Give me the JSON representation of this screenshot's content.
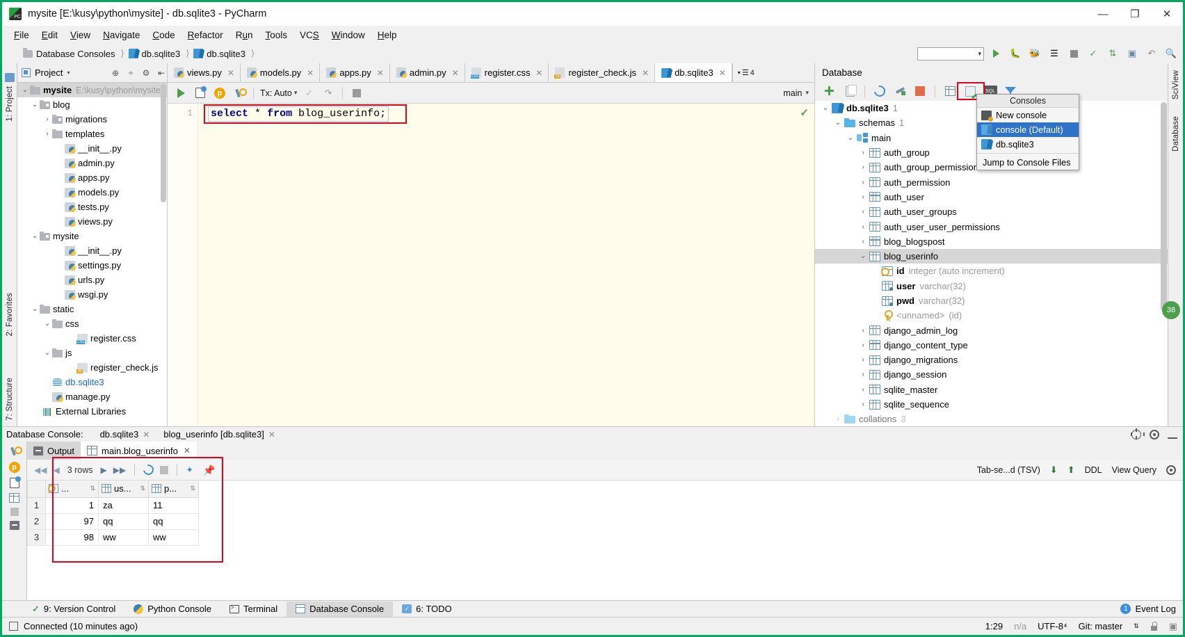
{
  "window": {
    "title": "mysite [E:\\kusy\\python\\mysite] - db.sqlite3 - PyCharm",
    "minimize": "—",
    "maximize": "❐",
    "close": "✕"
  },
  "menubar": [
    {
      "label": "File"
    },
    {
      "label": "Edit"
    },
    {
      "label": "View"
    },
    {
      "label": "Navigate"
    },
    {
      "label": "Code"
    },
    {
      "label": "Refactor"
    },
    {
      "label": "Run"
    },
    {
      "label": "Tools"
    },
    {
      "label": "VCS"
    },
    {
      "label": "Window"
    },
    {
      "label": "Help"
    }
  ],
  "breadcrumb": [
    {
      "label": "Database Consoles",
      "icon": "folder-icon"
    },
    {
      "label": "db.sqlite3",
      "icon": "console-icon"
    },
    {
      "label": "db.sqlite3",
      "icon": "console-icon"
    }
  ],
  "project_panel": {
    "title": "Project",
    "tree": [
      {
        "label": "mysite",
        "path": "E:\\kusy\\python\\mysite",
        "indent": 0,
        "arrow": "⌄",
        "icon": "folder-icon",
        "bold": true,
        "selected": true
      },
      {
        "label": "blog",
        "indent": 1,
        "arrow": "⌄",
        "icon": "source-folder-icon"
      },
      {
        "label": "migrations",
        "indent": 2,
        "arrow": "›",
        "icon": "source-folder-icon"
      },
      {
        "label": "templates",
        "indent": 2,
        "arrow": "›",
        "icon": "folder-icon"
      },
      {
        "label": "__init__.py",
        "indent": 3,
        "arrow": "",
        "icon": "python-file-icon"
      },
      {
        "label": "admin.py",
        "indent": 3,
        "arrow": "",
        "icon": "python-file-icon"
      },
      {
        "label": "apps.py",
        "indent": 3,
        "arrow": "",
        "icon": "python-file-icon"
      },
      {
        "label": "models.py",
        "indent": 3,
        "arrow": "",
        "icon": "python-file-icon"
      },
      {
        "label": "tests.py",
        "indent": 3,
        "arrow": "",
        "icon": "python-file-icon"
      },
      {
        "label": "views.py",
        "indent": 3,
        "arrow": "",
        "icon": "python-file-icon"
      },
      {
        "label": "mysite",
        "indent": 1,
        "arrow": "⌄",
        "icon": "source-folder-icon"
      },
      {
        "label": "__init__.py",
        "indent": 3,
        "arrow": "",
        "icon": "python-file-icon"
      },
      {
        "label": "settings.py",
        "indent": 3,
        "arrow": "",
        "icon": "python-file-icon"
      },
      {
        "label": "urls.py",
        "indent": 3,
        "arrow": "",
        "icon": "python-file-icon"
      },
      {
        "label": "wsgi.py",
        "indent": 3,
        "arrow": "",
        "icon": "python-file-icon"
      },
      {
        "label": "static",
        "indent": 1,
        "arrow": "⌄",
        "icon": "folder-icon"
      },
      {
        "label": "css",
        "indent": 2,
        "arrow": "⌄",
        "icon": "folder-icon"
      },
      {
        "label": "register.css",
        "indent": 4,
        "arrow": "",
        "icon": "css-file-icon"
      },
      {
        "label": "js",
        "indent": 2,
        "arrow": "⌄",
        "icon": "folder-icon"
      },
      {
        "label": "register_check.js",
        "indent": 4,
        "arrow": "",
        "icon": "js-file-icon"
      },
      {
        "label": "db.sqlite3",
        "indent": 1,
        "arrow": "",
        "icon": "database-file-icon",
        "link": true
      },
      {
        "label": "manage.py",
        "indent": 1,
        "arrow": "",
        "icon": "python-file-icon"
      },
      {
        "label": "External Libraries",
        "indent": 0,
        "arrow": "",
        "icon": "library-icon"
      }
    ]
  },
  "editor_tabs": [
    {
      "label": "views.py",
      "icon": "python-file-icon",
      "active": false
    },
    {
      "label": "models.py",
      "icon": "python-file-icon",
      "active": false
    },
    {
      "label": "apps.py",
      "icon": "python-file-icon",
      "active": false
    },
    {
      "label": "admin.py",
      "icon": "python-file-icon",
      "active": false
    },
    {
      "label": "register.css",
      "icon": "css-file-icon",
      "active": false
    },
    {
      "label": "register_check.js",
      "icon": "js-file-icon",
      "active": false
    },
    {
      "label": "db.sqlite3",
      "icon": "console-icon",
      "active": true
    }
  ],
  "tab_overflow": "4",
  "sql_toolbar": {
    "run_tooltip": "Execute",
    "tx_label": "Tx: Auto",
    "schema": "main"
  },
  "sql_editor": {
    "line_number": "1",
    "code_keyword1": "select",
    "code_star": "*",
    "code_keyword2": "from",
    "code_table": "blog_userinfo;"
  },
  "database_panel": {
    "title": "Database",
    "toolbar_icons": [
      "add-icon",
      "copy-icon",
      "sync-icon",
      "data-source-properties-icon",
      "stop-icon",
      "table-editor-icon",
      "run-script-icon",
      "sql-console-icon",
      "filter-icon"
    ],
    "tree": [
      {
        "label": "db.sqlite3",
        "badge": "1",
        "indent": 0,
        "arrow": "⌄",
        "icon": "console-icon",
        "bold": true
      },
      {
        "label": "schemas",
        "badge": "1",
        "indent": 1,
        "arrow": "⌄",
        "icon": "blue-folder-icon"
      },
      {
        "label": "main",
        "indent": 2,
        "arrow": "⌄",
        "icon": "schema-icon"
      },
      {
        "label": "auth_group",
        "indent": 3,
        "arrow": "›",
        "icon": "table-icon"
      },
      {
        "label": "auth_group_permissions",
        "indent": 3,
        "arrow": "›",
        "icon": "table-icon"
      },
      {
        "label": "auth_permission",
        "indent": 3,
        "arrow": "›",
        "icon": "table-icon"
      },
      {
        "label": "auth_user",
        "indent": 3,
        "arrow": "›",
        "icon": "table-icon"
      },
      {
        "label": "auth_user_groups",
        "indent": 3,
        "arrow": "›",
        "icon": "table-icon"
      },
      {
        "label": "auth_user_user_permissions",
        "indent": 3,
        "arrow": "›",
        "icon": "table-icon"
      },
      {
        "label": "blog_blogspost",
        "indent": 3,
        "arrow": "›",
        "icon": "table-icon"
      },
      {
        "label": "blog_userinfo",
        "indent": 3,
        "arrow": "⌄",
        "icon": "table-icon",
        "selected": true
      },
      {
        "label": "id",
        "type": "integer (auto increment)",
        "indent": 4,
        "arrow": "",
        "icon": "primary-key-column-icon"
      },
      {
        "label": "user",
        "type": "varchar(32)",
        "indent": 4,
        "arrow": "",
        "icon": "column-icon"
      },
      {
        "label": "pwd",
        "type": "varchar(32)",
        "indent": 4,
        "arrow": "",
        "icon": "column-icon"
      },
      {
        "label": "<unnamed>",
        "type": "(id)",
        "indent": 4,
        "arrow": "",
        "icon": "key-icon",
        "muted": true
      },
      {
        "label": "django_admin_log",
        "indent": 3,
        "arrow": "›",
        "icon": "table-icon"
      },
      {
        "label": "django_content_type",
        "indent": 3,
        "arrow": "›",
        "icon": "table-icon"
      },
      {
        "label": "django_migrations",
        "indent": 3,
        "arrow": "›",
        "icon": "table-icon"
      },
      {
        "label": "django_session",
        "indent": 3,
        "arrow": "›",
        "icon": "table-icon"
      },
      {
        "label": "sqlite_master",
        "indent": 3,
        "arrow": "›",
        "icon": "table-icon"
      },
      {
        "label": "sqlite_sequence",
        "indent": 3,
        "arrow": "›",
        "icon": "table-icon"
      },
      {
        "label": "collations",
        "badge": "3",
        "indent": 1,
        "arrow": "›",
        "icon": "blue-folder-icon"
      }
    ]
  },
  "consoles_popup": {
    "title": "Consoles",
    "items": [
      {
        "label": "New console",
        "icon": "new-console-icon",
        "highlighted": false
      },
      {
        "label": "console (Default)",
        "icon": "console-icon",
        "highlighted": true
      },
      {
        "label": "db.sqlite3",
        "icon": "console-icon",
        "highlighted": false
      },
      {
        "label": "Jump to Console Files",
        "icon": "",
        "highlighted": false
      }
    ]
  },
  "bottom_console": {
    "label": "Database Console:",
    "tabs": [
      {
        "label": "db.sqlite3",
        "closable": true
      },
      {
        "label": "blog_userinfo [db.sqlite3]",
        "closable": true
      }
    ],
    "result_tabs": [
      {
        "label": "Output",
        "icon": "output-icon",
        "active": false
      },
      {
        "label": "main.blog_userinfo",
        "icon": "table-icon",
        "active": true
      }
    ],
    "toolbar": {
      "first_page": "◀◀",
      "prev_page": "◀",
      "rows_label": "3 rows",
      "next_page": "▶",
      "last_page": "▶▶",
      "reload": "reload-icon",
      "stop": "stop-icon",
      "transpose": "value-editor-icon",
      "pin": "pin-tab-icon",
      "format_label": "Tab-se...d (TSV)",
      "download": "export-to-file-icon",
      "upload": "import-icon",
      "ddl_label": "DDL",
      "view_query_label": "View Query",
      "settings": "gear-icon"
    }
  },
  "results_grid": {
    "columns": [
      {
        "label": "...",
        "icon": "primary-key-column-icon"
      },
      {
        "label": "us...",
        "icon": "column-icon"
      },
      {
        "label": "p...",
        "icon": "column-icon"
      }
    ],
    "rows": [
      {
        "n": "1",
        "cells": [
          "1",
          "za",
          "11"
        ]
      },
      {
        "n": "2",
        "cells": [
          "97",
          "qq",
          "qq"
        ]
      },
      {
        "n": "3",
        "cells": [
          "98",
          "ww",
          "ww"
        ]
      }
    ]
  },
  "left_rail": [
    {
      "label": "1: Project"
    },
    {
      "label": "2: Favorites"
    },
    {
      "label": "7: Structure"
    }
  ],
  "right_rail": [
    {
      "label": "SciView"
    },
    {
      "label": "Database"
    }
  ],
  "float_badge": "38",
  "toolwindow_bar": {
    "items": [
      {
        "label": "9: Version Control",
        "icon": "vcs-icon",
        "active": false
      },
      {
        "label": "Python Console",
        "icon": "python-console-icon",
        "active": false
      },
      {
        "label": "Terminal",
        "icon": "terminal-icon",
        "active": false
      },
      {
        "label": "Database Console",
        "icon": "database-console-icon",
        "active": true
      },
      {
        "label": "6: TODO",
        "icon": "todo-icon",
        "active": false
      }
    ],
    "event_log": "Event Log",
    "event_badge": "1"
  },
  "statusbar": {
    "message": "Connected (10 minutes ago)",
    "caret": "1:29",
    "line_sep": "n/a",
    "encoding": "UTF-8⁴",
    "branch": "Git: master",
    "lock": "lock-icon"
  }
}
